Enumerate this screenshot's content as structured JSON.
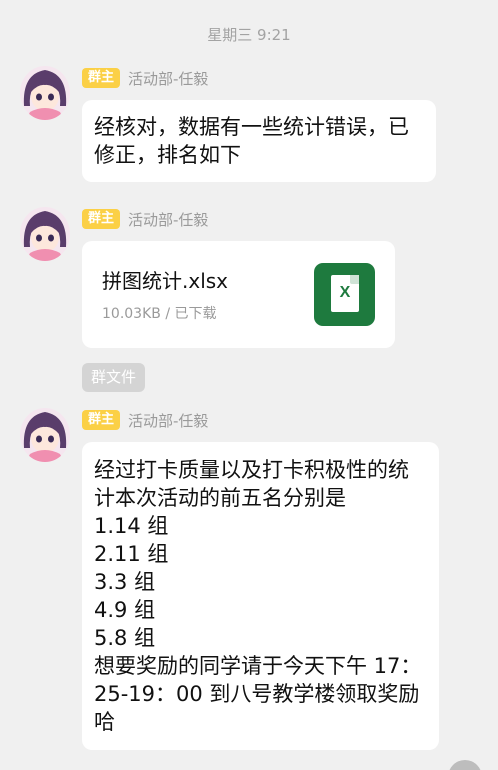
{
  "timestamp": "星期三 9:21",
  "messages": [
    {
      "badge": "群主",
      "sender": "活动部-任毅",
      "lines": [
        "经核对，数据有一些统计错误，已",
        "修正，排名如下"
      ]
    },
    {
      "badge": "群主",
      "sender": "活动部-任毅",
      "file": {
        "name": "拼图统计.xlsx",
        "meta": "10.03KB / 已下载",
        "icon_letter": "X"
      }
    },
    {
      "badge": "群主",
      "sender": "活动部-任毅",
      "lines": [
        "经过打卡质量以及打卡积极性的统",
        "计本次活动的前五名分别是",
        "1.14 组",
        "2.11 组",
        "3.3 组",
        "4.9 组",
        "5.8 组",
        "想要奖励的同学请于今天下午 17：",
        "25-19：00 到八号教学楼领取奖励",
        "哈"
      ]
    }
  ],
  "group_file_tag": "群文件",
  "colors": {
    "badge": "#fbd046",
    "excel_green": "#1e7a3e",
    "background": "#f0f0f0"
  }
}
